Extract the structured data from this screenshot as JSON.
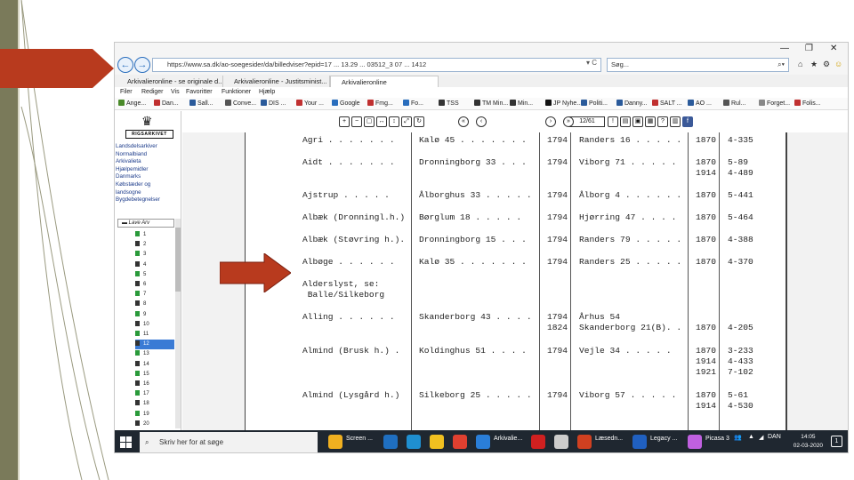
{
  "browser": {
    "url": "https://www.sa.dk/ao-soegesider/da/billedviser?epid=17 ... 13.29 ... 03512_3 07 ... 1412",
    "search_placeholder": "Søg...",
    "tabs": [
      {
        "label": "Arkivalieronline - se originale d..."
      },
      {
        "label": "Arkivalieronline - Justitsminist..."
      },
      {
        "label": "Arkivalieronline"
      }
    ],
    "menu": [
      "Filer",
      "Rediger",
      "Vis",
      "Favoritter",
      "Funktioner",
      "Hjælp"
    ],
    "favorites": [
      {
        "label": "Ange...",
        "color": "#4a8a2a"
      },
      {
        "label": "Dan...",
        "color": "#c03030"
      },
      {
        "label": "Sall...",
        "color": "#2a5a9a"
      },
      {
        "label": "Conve...",
        "color": "#555555"
      },
      {
        "label": "DIS ...",
        "color": "#2a5a9a"
      },
      {
        "label": "Your ...",
        "color": "#c03030"
      },
      {
        "label": "Google",
        "color": "#2a6ebd"
      },
      {
        "label": "Fmg...",
        "color": "#c03030"
      },
      {
        "label": "Fo...",
        "color": "#2a6ebd"
      },
      {
        "label": "TSS",
        "color": "#333333"
      },
      {
        "label": "TM Min...",
        "color": "#333333"
      },
      {
        "label": "Min...",
        "color": "#333333"
      },
      {
        "label": "JP Nyhe...",
        "color": "#111111"
      },
      {
        "label": "Politi...",
        "color": "#2a5a9a"
      },
      {
        "label": "Danny...",
        "color": "#2a5a9a"
      },
      {
        "label": "SALT ...",
        "color": "#c03030"
      },
      {
        "label": "AO ...",
        "color": "#2a5a9a"
      },
      {
        "label": "Rul...",
        "color": "#555555"
      },
      {
        "label": "Forget...",
        "color": "#888888"
      },
      {
        "label": "Folis...",
        "color": "#c03030"
      }
    ]
  },
  "left_panel": {
    "logo_text": "RIGSARKIVET",
    "links": [
      "Landsdelsarkiver",
      "Normalbiand",
      "Arkivalieta",
      "Hjælpemidler",
      "Danmarks",
      "Købstæder og",
      "landsogne",
      "Bygdebetegnelser"
    ],
    "tree_head": "Lave Arv",
    "tree_items": [
      "1",
      "2",
      "3",
      "4",
      "5",
      "6",
      "7",
      "8",
      "9",
      "10",
      "11",
      "12",
      "13",
      "14",
      "15",
      "16",
      "17",
      "18",
      "19",
      "20"
    ],
    "selected_item": "12"
  },
  "viewer": {
    "page_indicator": "12/61"
  },
  "document": {
    "rows": [
      {
        "name": "Agri . . . . . . .",
        "district": "Kalø 45 . . . . . . .",
        "year1": "1794",
        "place1": "Randers 16 . . . . .",
        "year2": "1870",
        "ref": "4-335"
      },
      {
        "name": "Aidt . . . . . . .",
        "district": "Dronningborg 33 . . .",
        "year1": "1794",
        "place1": "Viborg 71 . . . . .",
        "year2": "1870",
        "ref": "5-89"
      },
      {
        "name": "",
        "district": "",
        "year1": "",
        "place1": "",
        "year2": "1914",
        "ref": "4-489"
      },
      {
        "name": "Ajstrup . . . . .",
        "district": "Ålborghus 33 . . . . .",
        "year1": "1794",
        "place1": "Ålborg 4 . . . . . .",
        "year2": "1870",
        "ref": "5-441"
      },
      {
        "name": "Albæk (Dronningl.h.)",
        "district": "Børglum 18 . . . . .",
        "year1": "1794",
        "place1": "Hjørring 47 . . . .",
        "year2": "1870",
        "ref": "5-464"
      },
      {
        "name": "Albæk (Støvring h.).",
        "district": "Dronningborg 15 . . .",
        "year1": "1794",
        "place1": "Randers 79 . . . . .",
        "year2": "1870",
        "ref": "4-388"
      },
      {
        "name": "Albøge . . . . . .",
        "district": "Kalø 35 . . . . . . .",
        "year1": "1794",
        "place1": "Randers 25 . . . . .",
        "year2": "1870",
        "ref": "4-370"
      },
      {
        "name": "Alderslyst, se:",
        "district": "",
        "year1": "",
        "place1": "",
        "year2": "",
        "ref": ""
      },
      {
        "name": " Balle/Silkeborg",
        "district": "",
        "year1": "",
        "place1": "",
        "year2": "",
        "ref": ""
      },
      {
        "name": "Alling . . . . . .",
        "district": "Skanderborg 43 . . . .",
        "year1": "1794",
        "place1": "Århus 54",
        "year2": "",
        "ref": ""
      },
      {
        "name": "",
        "district": "",
        "year1": "1824",
        "place1": "Skanderborg 21(B). .",
        "year2": "1870",
        "ref": "4-205"
      },
      {
        "name": "Almind (Brusk h.) .",
        "district": "Koldinghus 51 . . . .",
        "year1": "1794",
        "place1": "Vejle 34 . . . . .",
        "year2": "1870",
        "ref": "3-233"
      },
      {
        "name": "",
        "district": "",
        "year1": "",
        "place1": "",
        "year2": "1914",
        "ref": "4-433"
      },
      {
        "name": "",
        "district": "",
        "year1": "",
        "place1": "",
        "year2": "1921",
        "ref": "7-102"
      },
      {
        "name": "Almind (Lysgård h.)",
        "district": "Silkeborg 25 . . . . .",
        "year1": "1794",
        "place1": "Viborg 57 . . . . .",
        "year2": "1870",
        "ref": "5-61"
      },
      {
        "name": "",
        "district": "",
        "year1": "",
        "place1": "",
        "year2": "1914",
        "ref": "4-530"
      }
    ]
  },
  "taskbar": {
    "search_placeholder": "Skriv her for at søge",
    "apps": [
      {
        "label": "Screen ...",
        "color": "#f0b020"
      },
      {
        "label": "",
        "color": "#1f6fc0"
      },
      {
        "label": "",
        "color": "#1f8fd0"
      },
      {
        "label": "",
        "color": "#f0c020"
      },
      {
        "label": "",
        "color": "#e04030"
      },
      {
        "label": "Arkivalie...",
        "color": "#2a7ed8"
      },
      {
        "label": "",
        "color": "#d02020"
      },
      {
        "label": "",
        "color": "#cccccc"
      },
      {
        "label": "Læsedn...",
        "color": "#d04020"
      },
      {
        "label": "Legacy ...",
        "color": "#2060c0"
      },
      {
        "label": "Picasa 3",
        "color": "#c060e0"
      }
    ],
    "lang": "DAN",
    "time": "14:05",
    "date": "02-03-2020",
    "notification_count": "1"
  }
}
